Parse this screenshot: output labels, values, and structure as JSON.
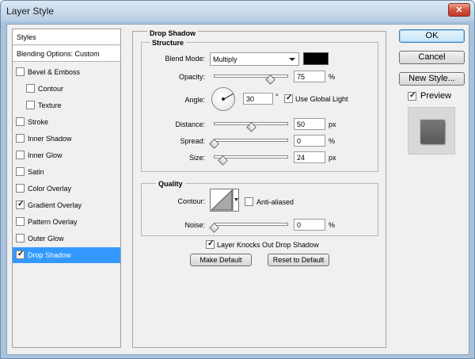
{
  "window": {
    "title": "Layer Style"
  },
  "icons": {
    "close": "close-icon",
    "dial": "angle-dial-icon",
    "contour": "contour-icon",
    "dropdown": "chevron-down-icon",
    "check": "check-icon"
  },
  "styles_list": {
    "header": "Styles",
    "blending": "Blending Options: Custom",
    "items": [
      {
        "label": "Bevel & Emboss",
        "checked": false,
        "indent": false
      },
      {
        "label": "Contour",
        "checked": false,
        "indent": true
      },
      {
        "label": "Texture",
        "checked": false,
        "indent": true
      },
      {
        "label": "Stroke",
        "checked": false,
        "indent": false
      },
      {
        "label": "Inner Shadow",
        "checked": false,
        "indent": false
      },
      {
        "label": "Inner Glow",
        "checked": false,
        "indent": false
      },
      {
        "label": "Satin",
        "checked": false,
        "indent": false
      },
      {
        "label": "Color Overlay",
        "checked": false,
        "indent": false
      },
      {
        "label": "Gradient Overlay",
        "checked": true,
        "indent": false
      },
      {
        "label": "Pattern Overlay",
        "checked": false,
        "indent": false
      },
      {
        "label": "Outer Glow",
        "checked": false,
        "indent": false
      },
      {
        "label": "Drop Shadow",
        "checked": true,
        "indent": false,
        "selected": true
      }
    ]
  },
  "panel": {
    "title": "Drop Shadow",
    "structure": {
      "title": "Structure",
      "blend_mode_label": "Blend Mode:",
      "blend_mode_value": "Multiply",
      "shadow_color": "#000000",
      "opacity_label": "Opacity:",
      "opacity_value": "75",
      "opacity_unit": "%",
      "opacity_level": 0.75,
      "angle_label": "Angle:",
      "angle_value": "30",
      "angle_unit": "°",
      "global_light_label": "Use Global Light",
      "global_light_checked": true,
      "distance_label": "Distance:",
      "distance_value": "50",
      "distance_unit": "px",
      "distance_level": 0.5,
      "spread_label": "Spread:",
      "spread_value": "0",
      "spread_unit": "%",
      "spread_level": 0,
      "size_label": "Size:",
      "size_value": "24",
      "size_unit": "px",
      "size_level": 0.12
    },
    "quality": {
      "title": "Quality",
      "contour_label": "Contour:",
      "anti_aliased_label": "Anti-aliased",
      "anti_aliased_checked": false,
      "noise_label": "Noise:",
      "noise_value": "0",
      "noise_unit": "%",
      "noise_level": 0
    },
    "knocks_out_label": "Layer Knocks Out Drop Shadow",
    "knocks_out_checked": true,
    "make_default": "Make Default",
    "reset_default": "Reset to Default"
  },
  "buttons": {
    "ok": "OK",
    "cancel": "Cancel",
    "new_style": "New Style..."
  },
  "preview": {
    "label": "Preview",
    "checked": true
  }
}
